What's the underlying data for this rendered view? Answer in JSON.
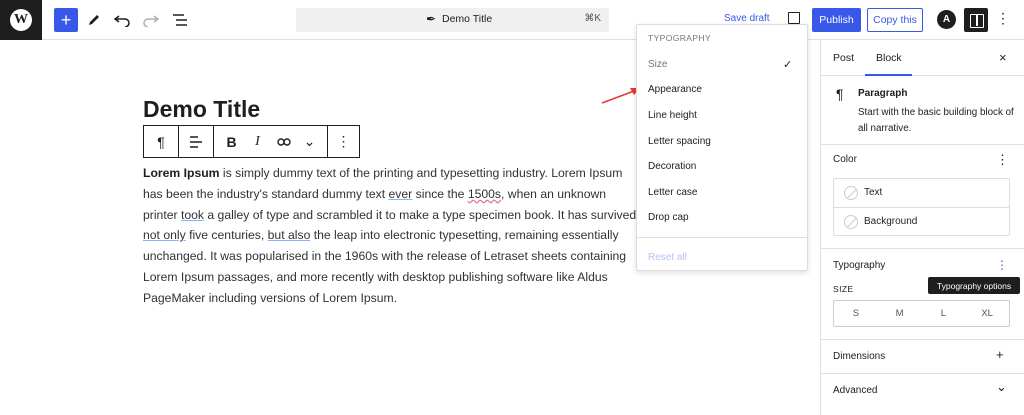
{
  "topbar": {
    "logo": "W",
    "add_label": "+",
    "doc_title": "Demo Title",
    "doc_shortcut": "⌘K",
    "save_draft": "Save draft",
    "publish": "Publish",
    "copy": "Copy this",
    "astra": "A",
    "more": "⋮"
  },
  "editor": {
    "title": "Demo Title",
    "paragraph": {
      "bold_lead": "Lorem Ipsum",
      "text_1": " is simply dummy text of the printing and typesetting industry. Lorem Ipsum has been the industry's standard dummy text ",
      "ever": "ever",
      "text_2": " since the ",
      "y1500s": "1500s",
      "text_3": ", when an unknown printer ",
      "took": "took",
      "text_4": " a galley of type and scrambled it to make a type specimen book. It has survived ",
      "not_only": "not only",
      "text_5": " five centuries, ",
      "but_also": "but also",
      "text_6": " the leap into electronic typesetting, remaining essentially unchanged. It was popularised in the 1960s with the release of Letraset sheets containing Lorem Ipsum passages, and more recently with desktop publishing software like Aldus PageMaker including versions of Lorem Ipsum."
    }
  },
  "dropdown": {
    "heading": "TYPOGRAPHY",
    "items": [
      "Size",
      "Appearance",
      "Line height",
      "Letter spacing",
      "Decoration",
      "Letter case",
      "Drop cap"
    ],
    "check": "✓",
    "reset": "Reset all"
  },
  "sidebar": {
    "tabs": [
      "Post",
      "Block"
    ],
    "close": "×",
    "block": {
      "title": "Paragraph",
      "description": "Start with the basic building block of all narrative."
    },
    "color": {
      "title": "Color",
      "options": [
        "Text",
        "Background"
      ]
    },
    "typography": {
      "title": "Typography",
      "size_label": "SIZE",
      "sizes": [
        "S",
        "M",
        "L",
        "XL"
      ],
      "tooltip": "Typography options"
    },
    "dimensions": "Dimensions",
    "advanced": "Advanced",
    "dots": "⋮",
    "plus": "+",
    "chevron": "⌄"
  },
  "colors": {
    "accent": "#3858e9",
    "dark": "#1e1e1e",
    "arrow": "#e53935"
  }
}
